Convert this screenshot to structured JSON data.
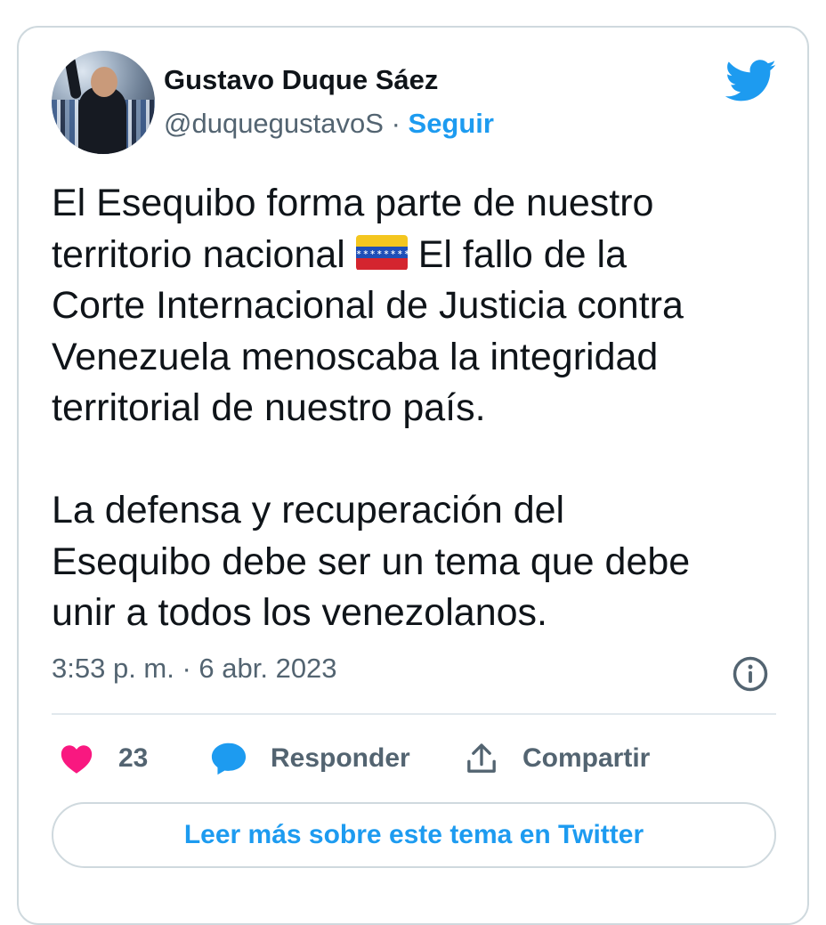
{
  "author": {
    "name": "Gustavo Duque Sáez",
    "handle": "@duquegustavoS",
    "separator": "·",
    "follow_label": "Seguir",
    "avatar_icon": "profile-photo"
  },
  "tweet": {
    "line1": "El Esequibo forma parte de nuestro",
    "line2_before_flag": "territorio nacional ",
    "flag_icon": "venezuela-flag-emoji",
    "line2_after_flag": " El fallo de la",
    "rest": "Corte Internacional de Justicia contra\nVenezuela menoscaba la integridad\nterritorial de nuestro país.\n\nLa defensa y recuperación del\nEsequibo debe ser un tema que debe\nunir a todos los venezolanos.",
    "timestamp": "3:53 p. m. · 6 abr. 2023"
  },
  "actions": {
    "like_count": "23",
    "reply_label": "Responder",
    "share_label": "Compartir"
  },
  "read_more_label": "Leer más sobre este tema en Twitter",
  "colors": {
    "accent": "#1d9bf0",
    "like": "#f91880",
    "secondary_text": "#536471",
    "border": "#cfd9de"
  }
}
